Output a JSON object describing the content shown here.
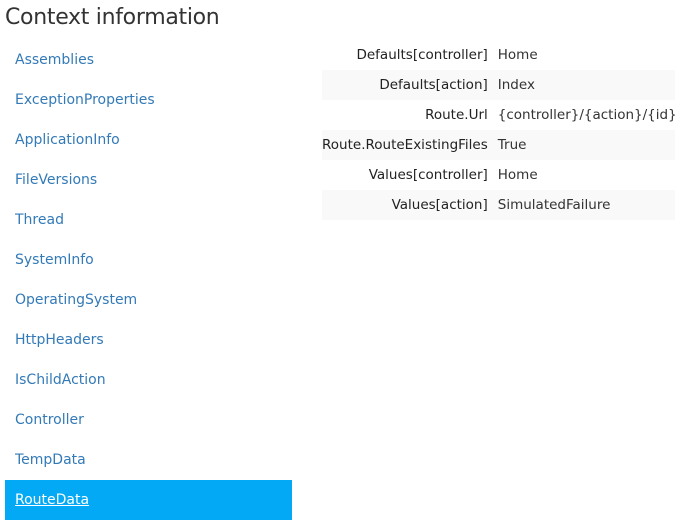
{
  "page": {
    "title": "Context information"
  },
  "sidebar": {
    "items": [
      {
        "label": "Assemblies"
      },
      {
        "label": "ExceptionProperties"
      },
      {
        "label": "ApplicationInfo"
      },
      {
        "label": "FileVersions"
      },
      {
        "label": "Thread"
      },
      {
        "label": "SystemInfo"
      },
      {
        "label": "OperatingSystem"
      },
      {
        "label": "HttpHeaders"
      },
      {
        "label": "IsChildAction"
      },
      {
        "label": "Controller"
      },
      {
        "label": "TempData"
      },
      {
        "label": "RouteData"
      }
    ],
    "active_item": "RouteData",
    "active_color": "#03a9f4",
    "link_color": "#337ab7"
  },
  "route_data": {
    "rows": [
      {
        "key": "Defaults[controller]",
        "value": "Home"
      },
      {
        "key": "Defaults[action]",
        "value": "Index"
      },
      {
        "key": "Route.Url",
        "value": "{controller}/{action}/{id}"
      },
      {
        "key": "Route.RouteExistingFiles",
        "value": "True"
      },
      {
        "key": "Values[controller]",
        "value": "Home"
      },
      {
        "key": "Values[action]",
        "value": "SimulatedFailure"
      }
    ]
  }
}
